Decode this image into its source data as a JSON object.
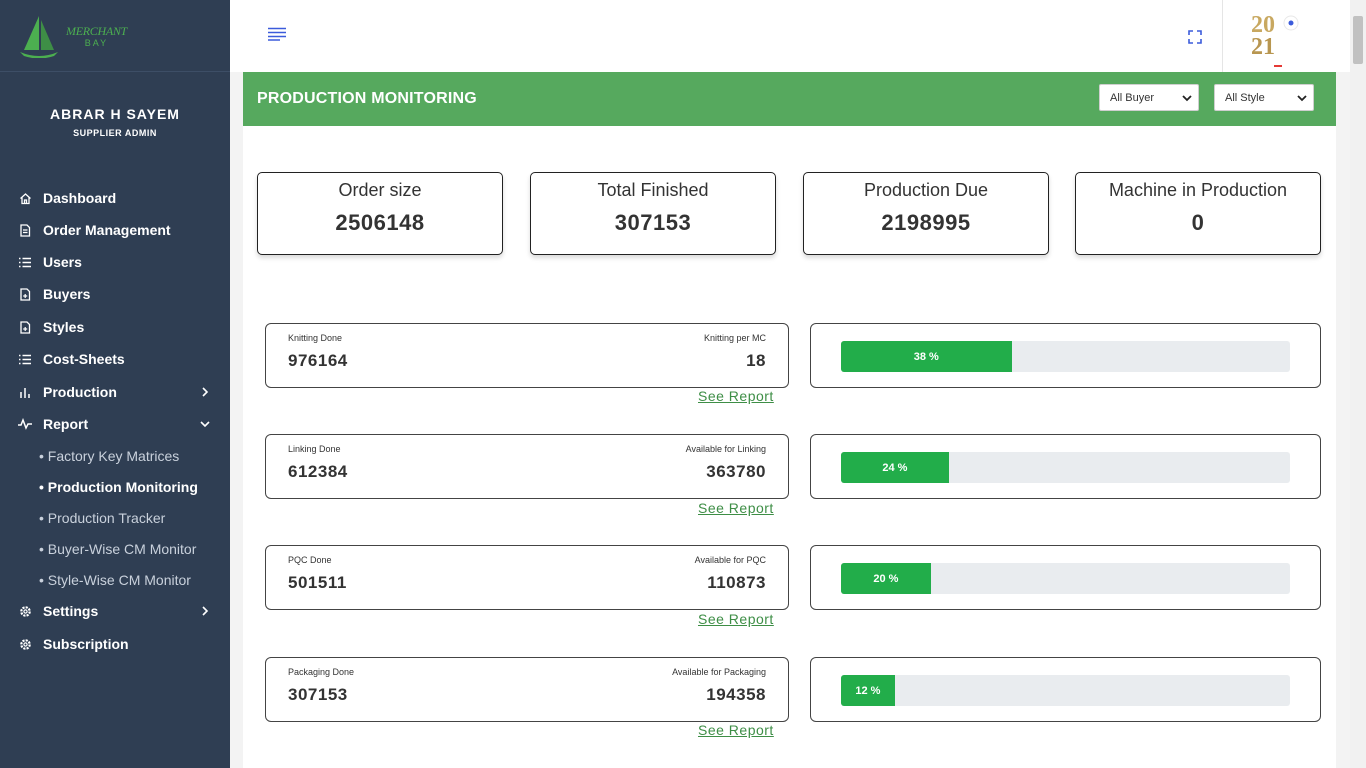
{
  "brand": {
    "line1": "MERCHANT",
    "line2": "BAY",
    "color": "#4caf50"
  },
  "user": {
    "name": "ABRAR H SAYEM",
    "role": "SUPPLIER ADMIN"
  },
  "nav": [
    {
      "label": "Dashboard",
      "icon": "home-icon"
    },
    {
      "label": "Order Management",
      "icon": "document-icon"
    },
    {
      "label": "Users",
      "icon": "list-icon"
    },
    {
      "label": "Buyers",
      "icon": "file-icon"
    },
    {
      "label": "Styles",
      "icon": "file-icon"
    },
    {
      "label": "Cost-Sheets",
      "icon": "list-icon"
    },
    {
      "label": "Production",
      "icon": "bar-chart-icon",
      "chevron": "chevron-right-icon"
    },
    {
      "label": "Report",
      "icon": "activity-icon",
      "chevron": "chevron-down-icon"
    },
    {
      "label": "Settings",
      "icon": "gear-icon",
      "chevron": "chevron-right-icon"
    },
    {
      "label": "Subscription",
      "icon": "gear-icon"
    }
  ],
  "report_sub": [
    {
      "label": "• Factory Key Matrices"
    },
    {
      "label": "• Production Monitoring",
      "active": true
    },
    {
      "label": "• Production Tracker"
    },
    {
      "label": "• Buyer-Wise CM Monitor"
    },
    {
      "label": "• Style-Wise CM Monitor"
    }
  ],
  "page": {
    "title": "PRODUCTION MONITORING",
    "buyer_select": "All Buyer",
    "style_select": "All Style",
    "header_color": "#56a95e"
  },
  "stats": [
    {
      "label": "Order size",
      "value": "2506148"
    },
    {
      "label": "Total Finished",
      "value": "307153"
    },
    {
      "label": "Production Due",
      "value": "2198995"
    },
    {
      "label": "Machine in Production",
      "value": "0"
    }
  ],
  "stages": [
    {
      "left_label": "Knitting Done",
      "left_value": "976164",
      "right_label": "Knitting per MC",
      "right_value": "18",
      "link": "See Report",
      "progress": 38,
      "progress_label": "38 %"
    },
    {
      "left_label": "Linking Done",
      "left_value": "612384",
      "right_label": "Available for Linking",
      "right_value": "363780",
      "link": "See Report",
      "progress": 24,
      "progress_label": "24 %"
    },
    {
      "left_label": "PQC Done",
      "left_value": "501511",
      "right_label": "Available for PQC",
      "right_value": "110873",
      "link": "See Report",
      "progress": 20,
      "progress_label": "20 %"
    },
    {
      "left_label": "Packaging Done",
      "left_value": "307153",
      "right_label": "Available for Packaging",
      "right_value": "194358",
      "link": "See Report",
      "progress": 12,
      "progress_label": "12 %"
    }
  ],
  "progress_color": "#22ad4a"
}
